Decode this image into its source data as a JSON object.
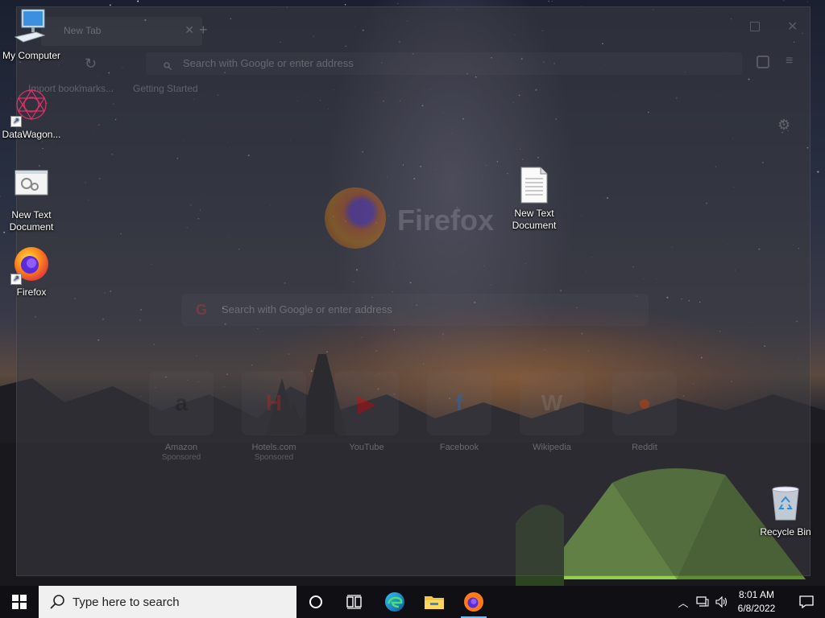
{
  "desktop": {
    "icons": [
      {
        "label": "My Computer"
      },
      {
        "label": "DataWagon..."
      },
      {
        "label": "New Text Document"
      },
      {
        "label": "Firefox"
      },
      {
        "label": "New Text Document"
      },
      {
        "label": "Recycle Bin"
      }
    ]
  },
  "firefox_window": {
    "tab_title": "New Tab",
    "urlbar_placeholder": "Search with Google or enter address",
    "bookmarks_label": "Import bookmarks...",
    "bookmark_getting_started": "Getting Started",
    "wordmark": "Firefox",
    "search_placeholder": "Search with Google or enter address",
    "tiles": [
      {
        "label": "Amazon",
        "sub": "Sponsored",
        "glyph": "a",
        "color": "#222222"
      },
      {
        "label": "Hotels.com",
        "sub": "Sponsored",
        "glyph": "H",
        "color": "#d32f2f"
      },
      {
        "label": "YouTube",
        "sub": "",
        "glyph": "▶",
        "color": "#ff0000"
      },
      {
        "label": "Facebook",
        "sub": "",
        "glyph": "f",
        "color": "#1877f2"
      },
      {
        "label": "Wikipedia",
        "sub": "",
        "glyph": "W",
        "color": "#888888"
      },
      {
        "label": "Reddit",
        "sub": "",
        "glyph": "●",
        "color": "#ff4500"
      }
    ]
  },
  "taskbar": {
    "search_placeholder": "Type here to search",
    "pinned": [
      "cortana-icon",
      "task-view-icon",
      "edge-icon",
      "file-explorer-icon",
      "firefox-icon"
    ],
    "clock_time": "8:01 AM",
    "clock_date": "6/8/2022"
  },
  "colors": {
    "taskbar_bg": "#101014",
    "search_box_bg": "#f0f0f0",
    "active_indicator": "#76b9ed"
  }
}
